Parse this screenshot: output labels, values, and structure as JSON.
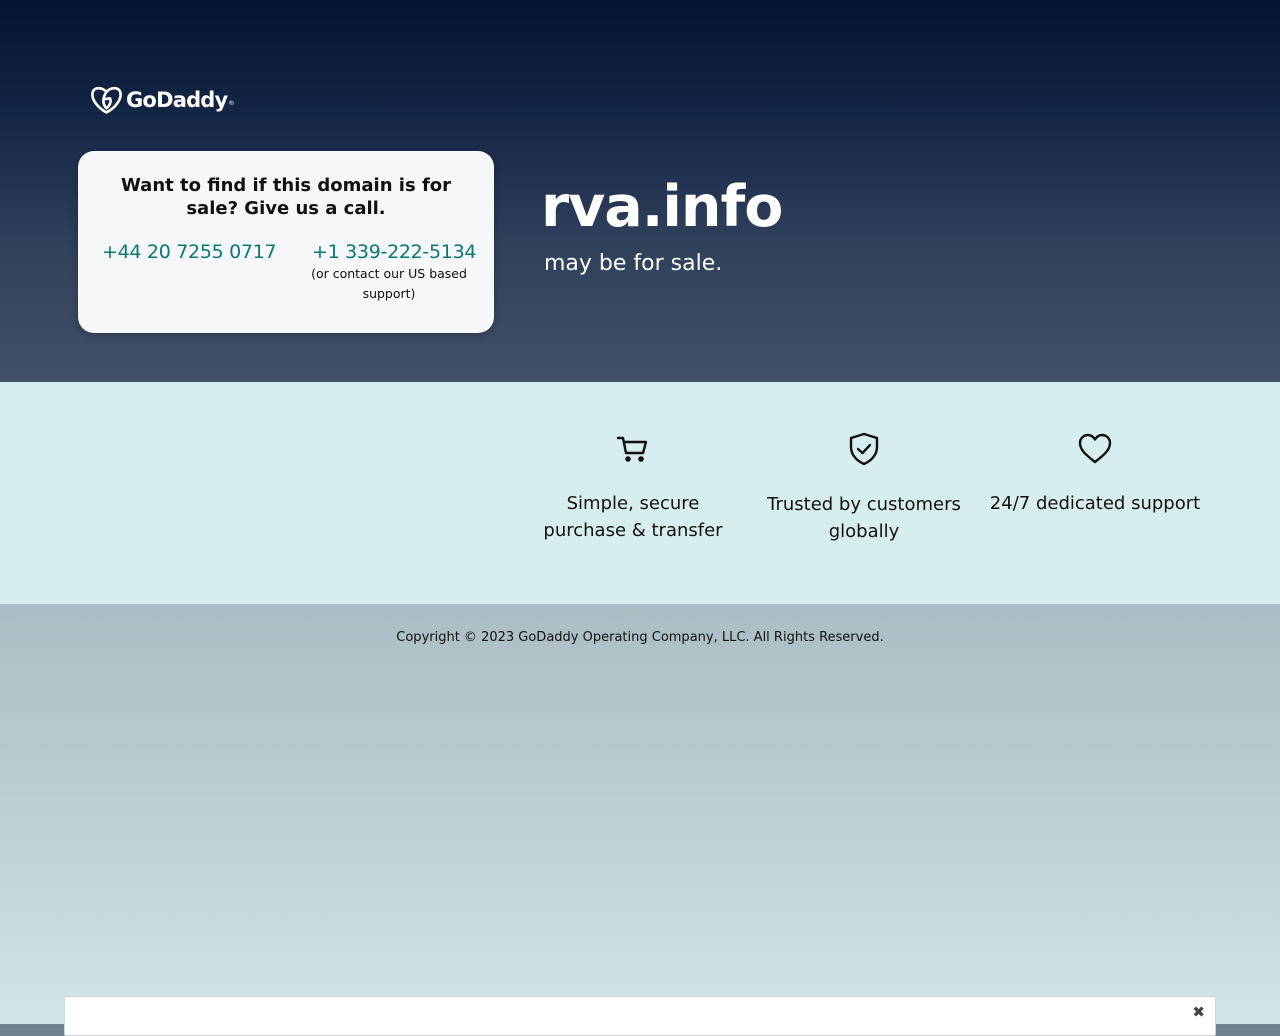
{
  "brand": {
    "name": "GoDaddy",
    "trademark": "®",
    "logo_icon": "godaddy-heart-logo"
  },
  "call_card": {
    "title": "Want to find if this domain is for sale? Give us a call.",
    "phone_uk": "+44 20 7255 0717",
    "phone_us": "+1 339-222-5134",
    "phone_us_note": "(or contact our US based support)"
  },
  "domain": {
    "name": "rva.info",
    "subtitle": "may be for sale."
  },
  "features": [
    {
      "icon": "cart-icon",
      "label": "Simple, secure purchase & transfer"
    },
    {
      "icon": "shield-check-icon",
      "label": "Trusted by customers globally"
    },
    {
      "icon": "heart-icon",
      "label": "24/7 dedicated support"
    }
  ],
  "footer": {
    "copyright": "Copyright © 2023 GoDaddy Operating Company, LLC. All Rights Reserved."
  },
  "banner": {
    "close_glyph": "✖"
  },
  "colors": {
    "hero_top": "#021430",
    "hero_bottom": "#425168",
    "phone_link": "#0c7777",
    "features_bg": "#d7eeee"
  }
}
